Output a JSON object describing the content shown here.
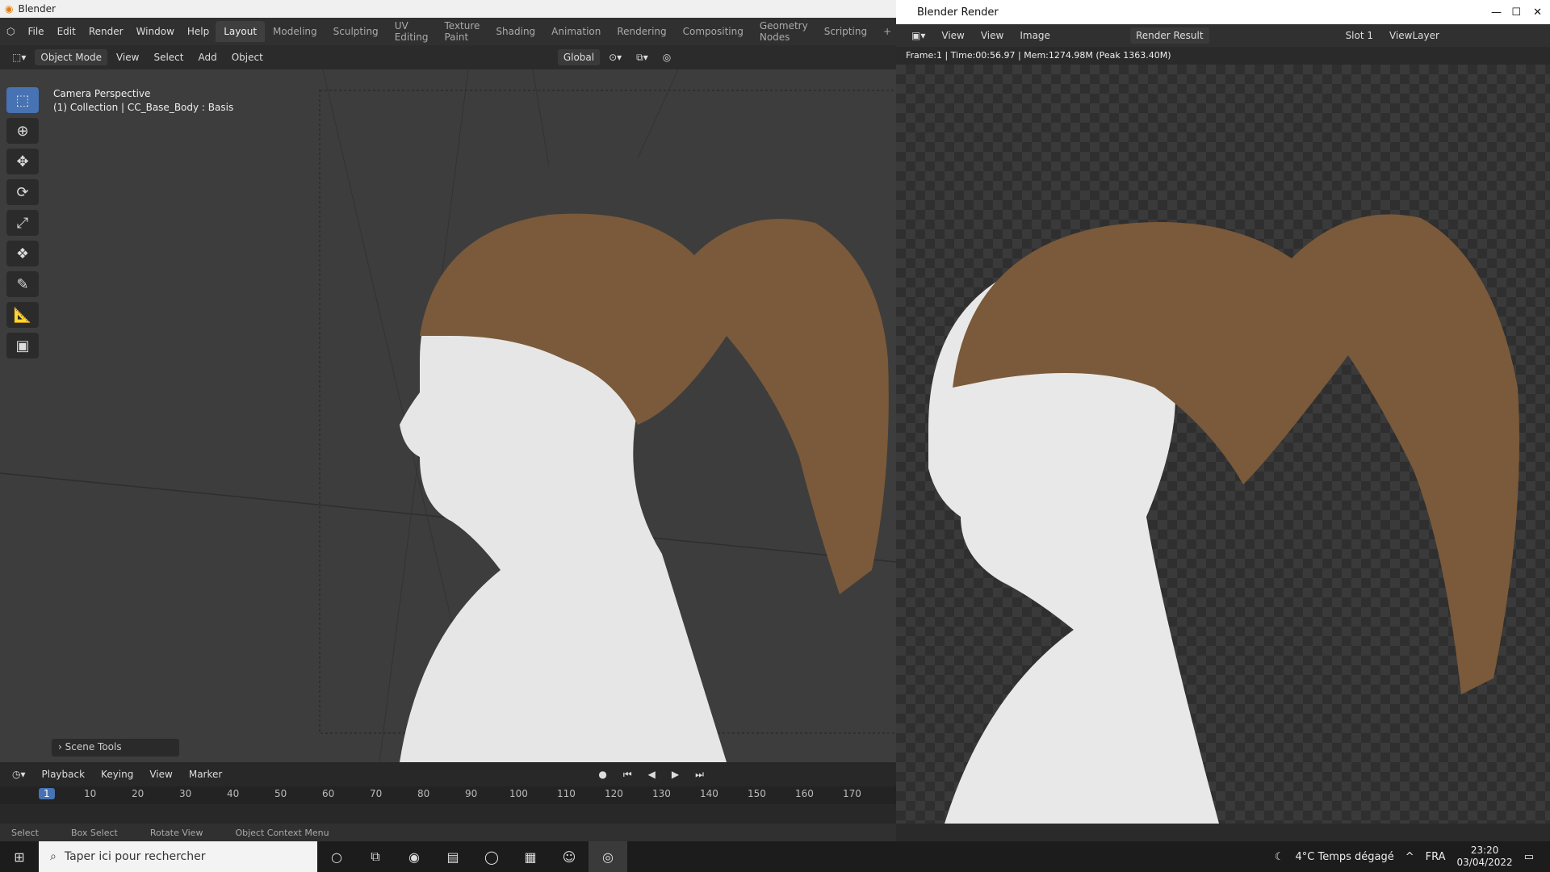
{
  "app": {
    "title": "Blender"
  },
  "menu": [
    "File",
    "Edit",
    "Render",
    "Window",
    "Help"
  ],
  "workspaces": [
    "Layout",
    "Modeling",
    "Sculpting",
    "UV Editing",
    "Texture Paint",
    "Shading",
    "Animation",
    "Rendering",
    "Compositing",
    "Geometry Nodes",
    "Scripting"
  ],
  "viewport_header": {
    "mode": "Object Mode",
    "menus": [
      "View",
      "Select",
      "Add",
      "Object"
    ],
    "orientation": "Global"
  },
  "viewport": {
    "camera": "Camera Perspective",
    "collection": "(1) Collection | CC_Base_Body : Basis",
    "scene_tools": "Scene Tools"
  },
  "timeline": {
    "menus": [
      "Playback",
      "Keying",
      "View",
      "Marker"
    ],
    "current_frame": "1",
    "ticks": [
      "10",
      "20",
      "30",
      "40",
      "50",
      "60",
      "70",
      "80",
      "90",
      "100",
      "110",
      "120",
      "130",
      "140",
      "150",
      "160",
      "170"
    ]
  },
  "status": [
    "Select",
    "Box Select",
    "Rotate View",
    "Object Context Menu"
  ],
  "render_window": {
    "title": "Blender Render",
    "menus": [
      "View",
      "View",
      "Image"
    ],
    "image_name": "Render Result",
    "slot": "Slot 1",
    "layer": "ViewLayer",
    "info": "Frame:1 | Time:00:56.97 | Mem:1274.98M (Peak 1363.40M)"
  },
  "taskbar": {
    "search_placeholder": "Taper ici pour rechercher",
    "weather": "4°C  Temps dégagé",
    "lang": "FRA",
    "time": "23:20",
    "date": "03/04/2022"
  }
}
